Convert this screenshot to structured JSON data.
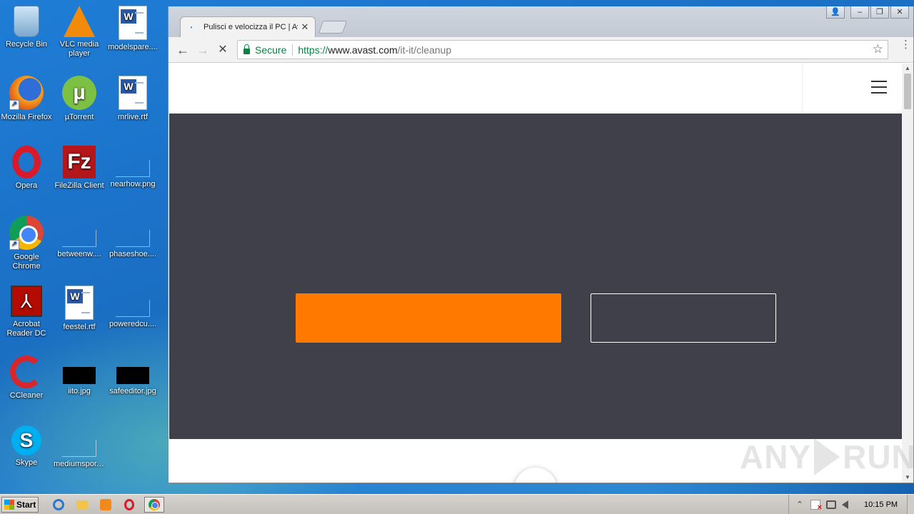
{
  "desktop": {
    "icons": [
      {
        "label": "Recycle Bin",
        "icon": "recycle-bin-icon"
      },
      {
        "label": "VLC media player",
        "icon": "vlc-icon"
      },
      {
        "label": "modelspare....",
        "icon": "word-document-icon"
      },
      {
        "label": "Mozilla Firefox",
        "icon": "firefox-icon"
      },
      {
        "label": "µTorrent",
        "icon": "utorrent-icon"
      },
      {
        "label": "mrlive.rtf",
        "icon": "word-document-icon"
      },
      {
        "label": "Opera",
        "icon": "opera-icon"
      },
      {
        "label": "FileZilla Client",
        "icon": "filezilla-icon"
      },
      {
        "label": "nearhow.png",
        "icon": "image-file-icon"
      },
      {
        "label": "Google Chrome",
        "icon": "chrome-icon"
      },
      {
        "label": "betweenw....",
        "icon": "file-icon"
      },
      {
        "label": "phaseshoe....",
        "icon": "file-icon"
      },
      {
        "label": "Acrobat Reader DC",
        "icon": "acrobat-icon"
      },
      {
        "label": "feestel.rtf",
        "icon": "word-document-icon"
      },
      {
        "label": "poweredcu....",
        "icon": "file-icon"
      },
      {
        "label": "CCleaner",
        "icon": "ccleaner-icon"
      },
      {
        "label": "iito.jpg",
        "icon": "image-file-icon"
      },
      {
        "label": "safeeditor.jpg",
        "icon": "image-file-icon"
      },
      {
        "label": "Skype",
        "icon": "skype-icon"
      },
      {
        "label": "mediumspor....",
        "icon": "file-icon"
      }
    ]
  },
  "browser": {
    "tab": {
      "title": "Pulisci e velocizza il PC | Avast",
      "close_glyph": "✕"
    },
    "window_controls": {
      "user": "👤",
      "minimize": "–",
      "restore": "❐",
      "close": "✕"
    },
    "nav": {
      "back": "←",
      "forward": "→",
      "reload": "✕"
    },
    "address": {
      "secure_label": "Secure",
      "scheme": "https://",
      "host": "www.avast.com",
      "path": "/it-it/cleanup"
    },
    "bookmark_glyph": "☆",
    "menu_glyph": "⋮"
  },
  "page": {
    "cta_primary_label": "",
    "cta_secondary_label": "",
    "accent_color": "#ff7800",
    "hero_color": "#40404a"
  },
  "watermark": {
    "left": "ANY",
    "right": "RUN"
  },
  "taskbar": {
    "start_label": "Start",
    "clock": "10:15 PM",
    "tray_expand_glyph": "⌃"
  }
}
